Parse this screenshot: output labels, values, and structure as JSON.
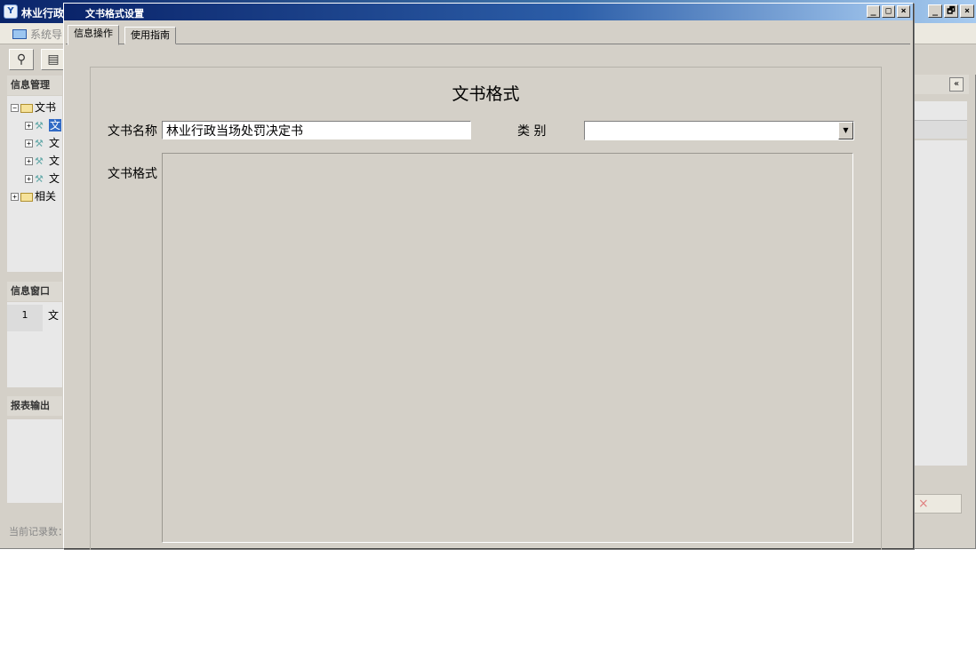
{
  "background_app": {
    "title": "林业行政",
    "nav_tab": "系统导",
    "sections": {
      "info_manage": "信息管理",
      "info_window": "信息窗口",
      "report_output": "报表输出"
    },
    "tree": [
      {
        "label": "文书",
        "type": "folder",
        "expanded": true
      },
      {
        "label": "文",
        "type": "item",
        "selected": true
      },
      {
        "label": "文",
        "type": "item"
      },
      {
        "label": "文",
        "type": "item"
      },
      {
        "label": "文",
        "type": "item"
      },
      {
        "label": "相关",
        "type": "folder",
        "expanded": false
      }
    ],
    "info_window_row": {
      "index": "1",
      "text": "文"
    },
    "status_text": "当前记录数：",
    "window_buttons": {
      "minimize": "_",
      "restore": "🗗",
      "close": "×"
    },
    "collapse_glyph": "«",
    "delete_glyph": "×"
  },
  "dialog": {
    "title": "文书格式设置",
    "buttons": {
      "minimize": "_",
      "maximize": "□",
      "close": "×"
    },
    "tabs": [
      {
        "label": "信息操作",
        "active": true
      },
      {
        "label": "使用指南",
        "active": false
      }
    ],
    "form": {
      "heading": "文书格式",
      "name_label": "文书名称",
      "name_value": "林业行政当场处罚决定书",
      "category_label": "类 别",
      "category_value": "",
      "format_label": "文书格式",
      "format_value": ""
    }
  },
  "colors": {
    "titlebar_start": "#0a246a",
    "titlebar_end": "#a6caf0",
    "dialog_face": "#d4d0c8",
    "selection": "#316ac5"
  }
}
